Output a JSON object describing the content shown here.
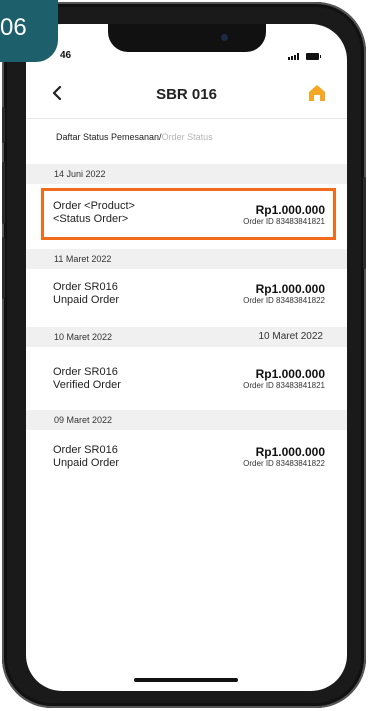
{
  "badge": {
    "number": "06"
  },
  "statusbar": {
    "time": "46",
    "signal_icon": "signal-bars-icon",
    "battery_icon": "battery-icon"
  },
  "header": {
    "title": "SBR 016",
    "back_icon": "chevron-left-icon",
    "home_icon": "home-icon",
    "accent": "#f5a623"
  },
  "breadcrumb": {
    "current": "Daftar Status Pemesanan/",
    "muted": "Order Status"
  },
  "groups": [
    {
      "date": "14 Juni 2022",
      "date_right": "",
      "order": {
        "name": "Order <Product>",
        "status": "<Status Order>",
        "price": "Rp1.000.000",
        "order_id": "Order ID 83483841821"
      }
    },
    {
      "date": "11 Maret 2022",
      "date_right": "",
      "order": {
        "name": "Order SR016",
        "status": "Unpaid Order",
        "price": "Rp1.000.000",
        "order_id": "Order ID 83483841822"
      }
    },
    {
      "date": "10 Maret 2022",
      "date_right": "10 Maret 2022",
      "order": {
        "name": "Order SR016",
        "status": "Verified Order",
        "price": "Rp1.000.000",
        "order_id": "Order ID 83483841821"
      }
    },
    {
      "date": "09 Maret 2022",
      "date_right": "",
      "order": {
        "name": "Order SR016",
        "status": "Unpaid Order",
        "price": "Rp1.000.000",
        "order_id": "Order ID 83483841822"
      }
    }
  ],
  "colors": {
    "highlight": "#f26a1b",
    "badge": "#1d5f6b"
  }
}
